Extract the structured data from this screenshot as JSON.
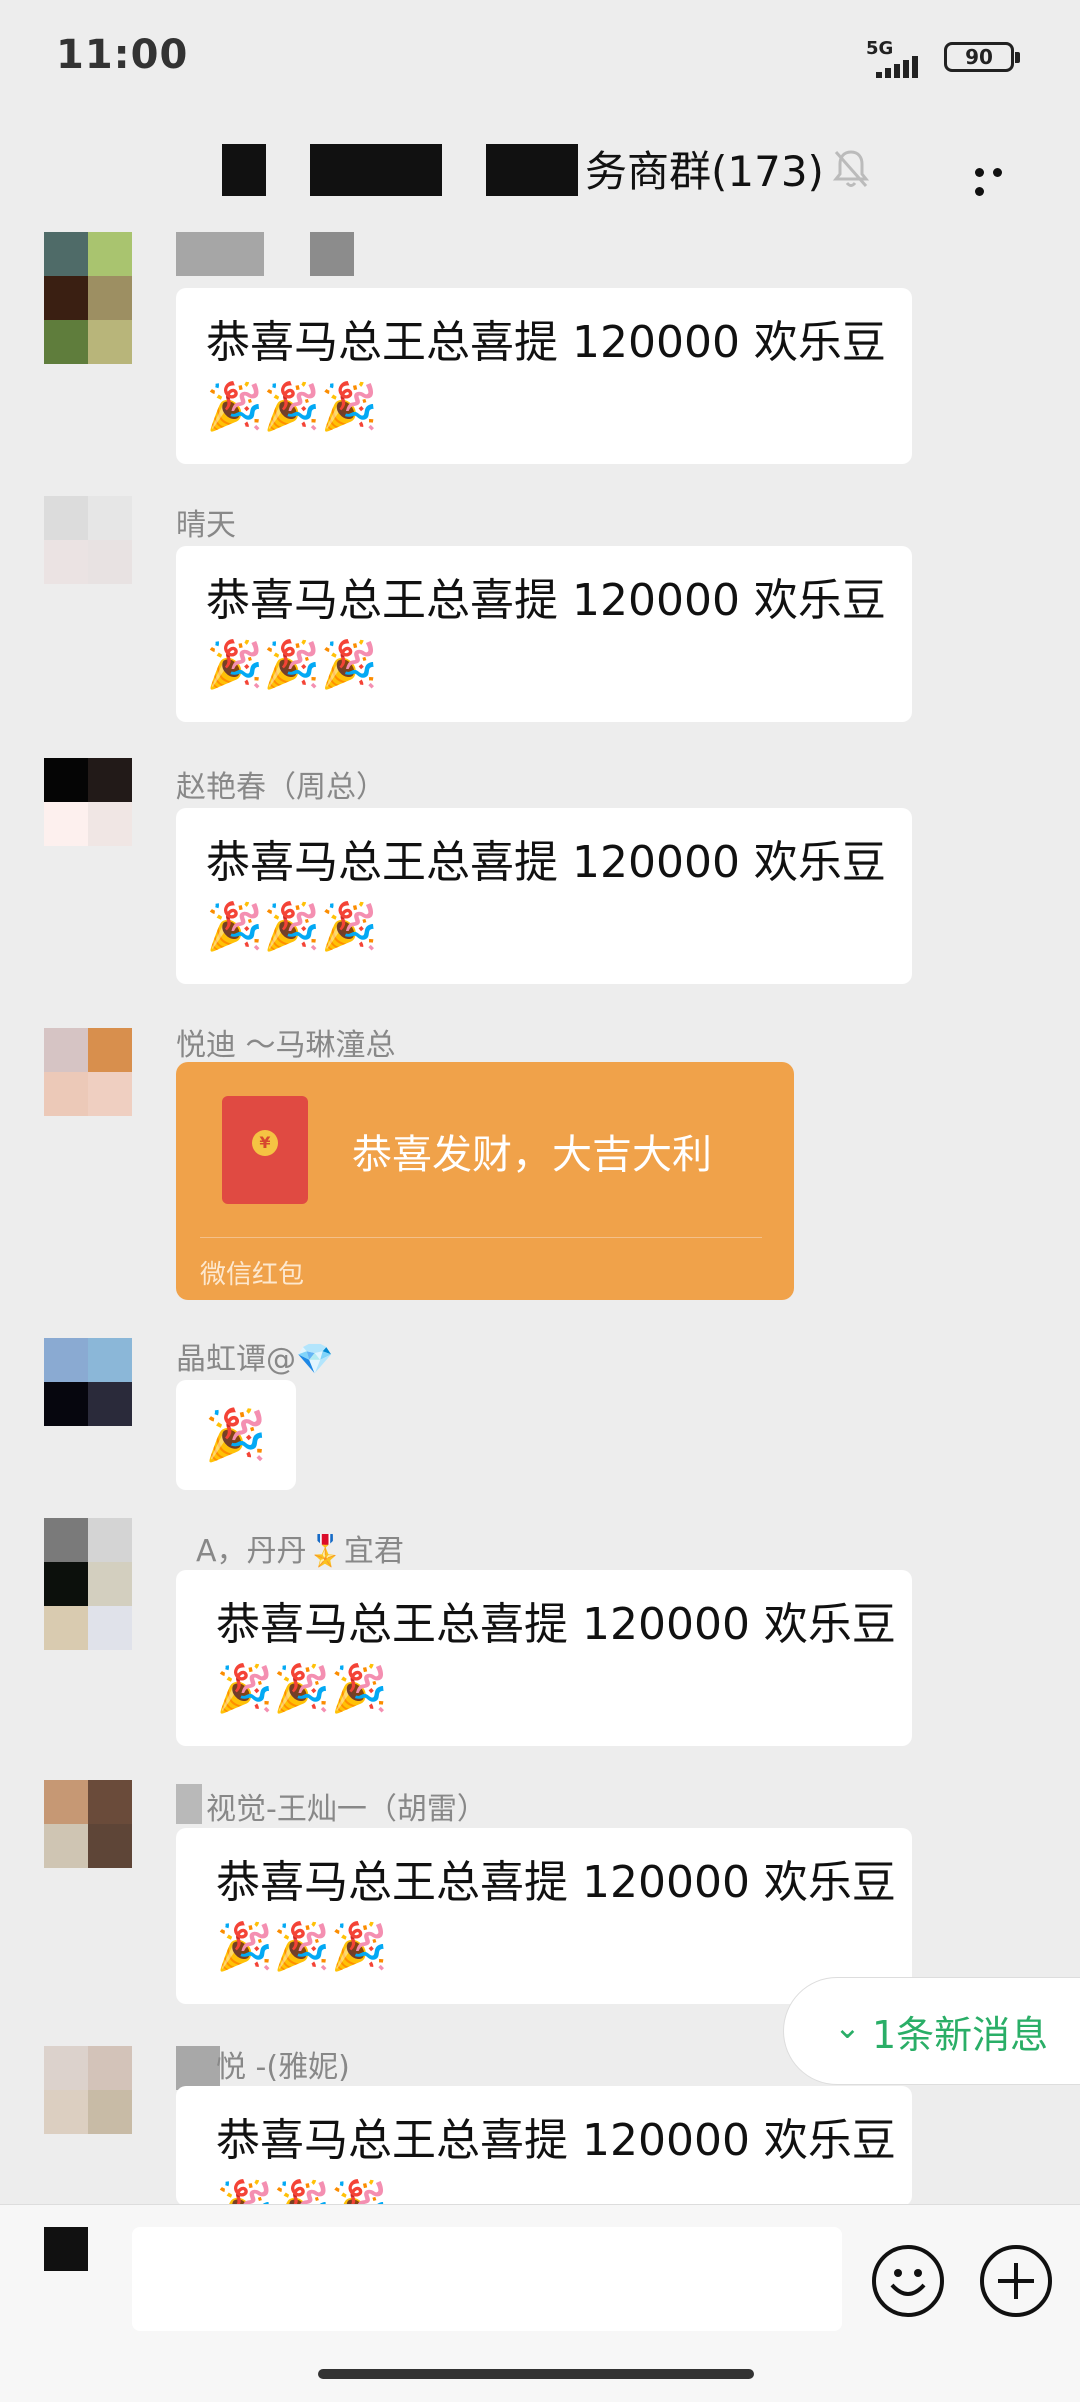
{
  "status": {
    "time": "11:00",
    "network": "5G",
    "battery": "90"
  },
  "header": {
    "title": "务商群(173)",
    "mute_icon": "bell-off-icon",
    "more_icon": "more-dots-icon"
  },
  "messages": [
    {
      "sender": "",
      "text": "恭喜马总王总喜提 120000 欢乐豆",
      "emoji": "🎉🎉🎉"
    },
    {
      "sender": "晴天",
      "text": "恭喜马总王总喜提 120000 欢乐豆",
      "emoji": "🎉🎉🎉"
    },
    {
      "sender": "赵艳春（周总）",
      "text": "恭喜马总王总喜提 120000 欢乐豆",
      "emoji": "🎉🎉🎉"
    },
    {
      "sender": "悦迪 ～马琳潼总"
    },
    {
      "sender": "晶虹谭@💎",
      "emoji": "🎉"
    },
    {
      "sender": "A，丹丹🎖️宜君",
      "text": "恭喜马总王总喜提 120000 欢乐豆",
      "emoji": "🎉🎉🎉"
    },
    {
      "sender": "视觉-王灿一（胡雷）",
      "text": "恭喜马总王总喜提 120000 欢乐豆",
      "emoji": "🎉🎉🎉"
    },
    {
      "sender": "悦 -(雅妮)",
      "text": "恭喜马总王总喜提 120000 欢乐豆",
      "emoji": "🎉🎉🎉"
    }
  ],
  "red_packet": {
    "text": "恭喜发财，大吉大利",
    "label": "微信红包",
    "coin": "¥"
  },
  "new_message": {
    "label": "1条新消息"
  },
  "colors": {
    "background": "#ededed",
    "bubble": "#ffffff",
    "red_packet": "#f0a24a",
    "accent_green": "#2aae67"
  }
}
